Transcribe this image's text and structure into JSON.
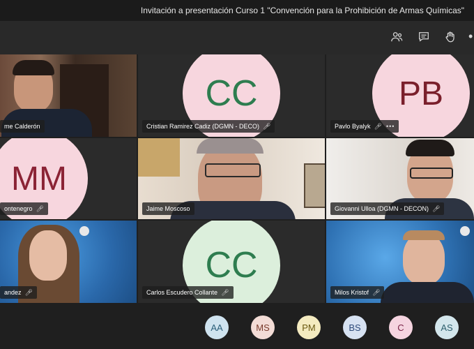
{
  "window": {
    "title": "Invitación a presentación Curso 1 \"Convención para la Prohibición de Armas Químicas\""
  },
  "toolbar": {
    "icons": [
      "participants-icon",
      "chat-icon",
      "raise-hand-icon",
      "more-options-icon"
    ],
    "more_label": "•"
  },
  "tiles": [
    {
      "name": "me Calderón",
      "type": "video"
    },
    {
      "name": "Cristian Ramirez Cadiz (DGMN - DECO)",
      "initials": "CC",
      "avatar_bg": "#f7d6de",
      "initials_color": "#2e7d4f",
      "type": "avatar"
    },
    {
      "name": "Pavlo Byalyk",
      "initials": "PB",
      "avatar_bg": "#f7d6de",
      "initials_color": "#7a1f2b",
      "type": "avatar",
      "more": "•••"
    },
    {
      "name": "ontenegro",
      "initials": "MM",
      "avatar_bg": "#f7d6de",
      "initials_color": "#8b2335",
      "type": "avatar"
    },
    {
      "name": "Jaime Moscoso",
      "type": "video"
    },
    {
      "name": "Giovanni Ulloa (DGMN - DECON)",
      "type": "video"
    },
    {
      "name": "andez",
      "type": "video"
    },
    {
      "name": "Carlos Escudero Collante",
      "initials": "CC",
      "avatar_bg": "#dcefdc",
      "initials_color": "#2e7d4f",
      "type": "avatar"
    },
    {
      "name": "Milos Kristof",
      "type": "video"
    }
  ],
  "bottom_avatars": [
    {
      "initials": "AA",
      "bg": "#cfe3ef",
      "color": "#2c5f7a"
    },
    {
      "initials": "MS",
      "bg": "#f3dcd6",
      "color": "#7a3b2c"
    },
    {
      "initials": "PM",
      "bg": "#f4ebc0",
      "color": "#6b5a12"
    },
    {
      "initials": "BS",
      "bg": "#d7e2f2",
      "color": "#2d4a7a"
    },
    {
      "initials": "C",
      "bg": "#f5d4e0",
      "color": "#7a2448"
    },
    {
      "initials": "AS",
      "bg": "#d3e6ec",
      "color": "#2e5f6d"
    }
  ],
  "colors": {
    "background": "#1f1f1f",
    "toolbar": "#292929",
    "label_bg": "#1e1e1e"
  }
}
